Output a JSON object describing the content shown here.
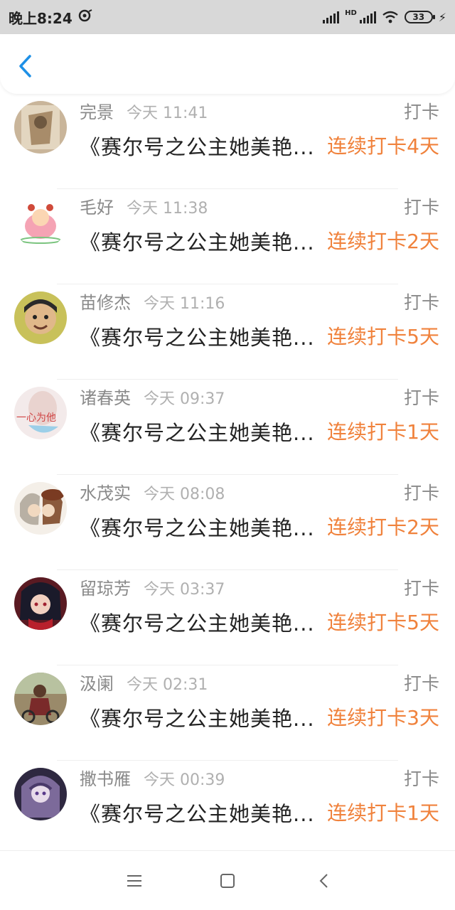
{
  "status_bar": {
    "time": "晚上8:24",
    "hd": "HD",
    "battery": "33"
  },
  "header": {
    "back_icon": "chevron-left-icon"
  },
  "list": [
    {
      "name": "完景",
      "time": "今天 11:41",
      "action": "打卡",
      "title": "《赛尔号之公主她美艳...",
      "streak": "连续打卡4天"
    },
    {
      "name": "毛好",
      "time": "今天 11:38",
      "action": "打卡",
      "title": "《赛尔号之公主她美艳...",
      "streak": "连续打卡2天"
    },
    {
      "name": "苗修杰",
      "time": "今天 11:16",
      "action": "打卡",
      "title": "《赛尔号之公主她美艳...",
      "streak": "连续打卡5天"
    },
    {
      "name": "诸春英",
      "time": "今天 09:37",
      "action": "打卡",
      "title": "《赛尔号之公主她美艳...",
      "streak": "连续打卡1天",
      "avatar_text": "一心为他"
    },
    {
      "name": "水茂实",
      "time": "今天 08:08",
      "action": "打卡",
      "title": "《赛尔号之公主她美艳...",
      "streak": "连续打卡2天"
    },
    {
      "name": "留琼芳",
      "time": "今天 03:37",
      "action": "打卡",
      "title": "《赛尔号之公主她美艳...",
      "streak": "连续打卡5天"
    },
    {
      "name": "汲阑",
      "time": "今天 02:31",
      "action": "打卡",
      "title": "《赛尔号之公主她美艳...",
      "streak": "连续打卡3天"
    },
    {
      "name": "撒书雁",
      "time": "今天 00:39",
      "action": "打卡",
      "title": "《赛尔号之公主她美艳...",
      "streak": "连续打卡1天"
    }
  ],
  "colors": {
    "accent": "#1e90e6",
    "streak": "#f0823c",
    "muted": "#8a8a8a"
  }
}
